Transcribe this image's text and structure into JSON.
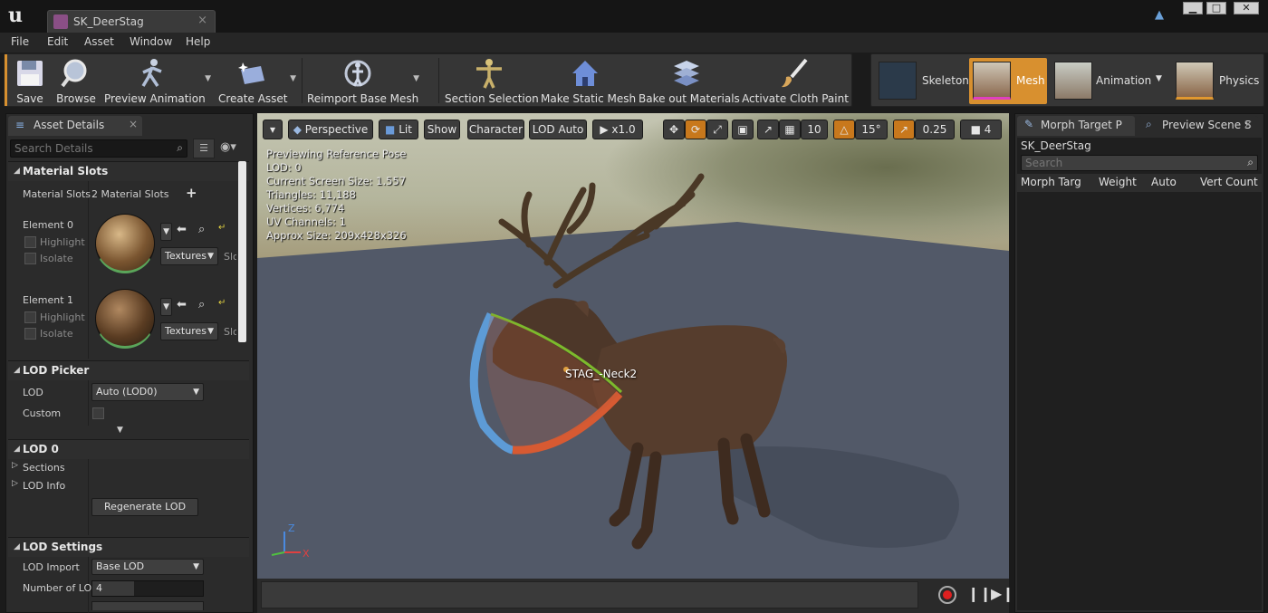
{
  "window": {
    "logo": "u",
    "tab_title": "SK_DeerStag",
    "tab_close": "×",
    "minimize": "▁",
    "maximize": "□",
    "close": "✕"
  },
  "menu": [
    "File",
    "Edit",
    "Asset",
    "Window",
    "Help"
  ],
  "toolbar": {
    "buttons": [
      "Save",
      "Browse",
      "Preview Animation",
      "Create Asset",
      "Reimport Base Mesh",
      "Section Selection",
      "Make Static Mesh",
      "Bake out Materials",
      "Activate Cloth Paint"
    ]
  },
  "modes": [
    "Skeleton",
    "Mesh",
    "Animation",
    "Physics"
  ],
  "accent_color": "#d8902f",
  "asset_details": {
    "tab_label": "Asset Details",
    "search_placeholder": "Search Details",
    "material_slots": {
      "header": "Material Slots",
      "label": "Material Slots",
      "value": "2 Material Slots",
      "add": "+",
      "elements": [
        {
          "label": "Element 0",
          "highlight": "Highlight",
          "isolate": "Isolate",
          "textures": "Textures",
          "slot": "Slot"
        },
        {
          "label": "Element 1",
          "highlight": "Highlight",
          "isolate": "Isolate",
          "textures": "Textures",
          "slot": "Slot N"
        }
      ]
    },
    "lod_picker": {
      "header": "LOD Picker",
      "lod_label": "LOD",
      "lod_value": "Auto (LOD0)",
      "custom_label": "Custom"
    },
    "lod0": {
      "header": "LOD 0",
      "sections": "Sections",
      "lod_info": "LOD Info",
      "regenerate": "Regenerate LOD"
    },
    "lod_settings": {
      "header": "LOD Settings",
      "lod_import_label": "LOD Import",
      "lod_import_value": "Base LOD",
      "number_label": "Number of LO",
      "number_value": "4"
    }
  },
  "viewport": {
    "buttons": {
      "perspective": "Perspective",
      "lit": "Lit",
      "show": "Show",
      "character": "Character",
      "lod_auto": "LOD Auto",
      "speed": "x1.0",
      "grid_snap": "10",
      "rot_snap": "15°",
      "scale_snap": "0.25",
      "cam_speed": "4"
    },
    "stats": [
      "Previewing Reference Pose",
      "LOD: 0",
      "Current Screen Size: 1.557",
      "Triangles: 11,188",
      "Vertices: 6,774",
      "UV Channels: 1",
      "Approx Size: 209x428x326"
    ],
    "bone_label": "STAG_-Neck2",
    "axis": {
      "z": "Z",
      "x": "X"
    }
  },
  "morph_panel": {
    "tab1": "Morph Target P",
    "tab2": "Preview Scene S",
    "title": "SK_DeerStag",
    "search_placeholder": "Search",
    "columns": [
      "Morph Targ",
      "Weight",
      "Auto",
      "Vert Count"
    ]
  }
}
